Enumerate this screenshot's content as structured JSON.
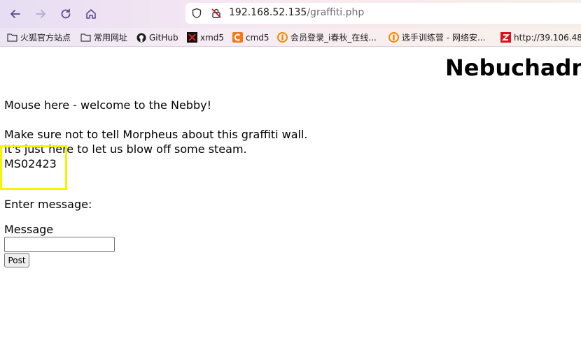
{
  "browser": {
    "url_host": "192.168.52.135",
    "url_path": "/graffiti.php",
    "accent_color": "#7b61b3",
    "bookmarks": [
      {
        "label": "火狐官方站点",
        "icon": "folder-icon"
      },
      {
        "label": "常用网址",
        "icon": "folder-icon"
      },
      {
        "label": "GitHub",
        "icon": "github-icon"
      },
      {
        "label": "xmd5",
        "icon": "xmd5-icon"
      },
      {
        "label": "cmd5",
        "icon": "cmd5-icon"
      },
      {
        "label": "会员登录_i春秋_在线...",
        "icon": "ichunqiu-icon"
      },
      {
        "label": "选手训练营 - 网络安...",
        "icon": "ichunqiu-icon"
      },
      {
        "label": "http://39.106.48...",
        "icon": "z-icon"
      }
    ]
  },
  "page": {
    "title": "Nebuchadne",
    "welcome": "Mouse here - welcome to the Nebby!",
    "graffiti": [
      "Make sure not to tell Morpheus about this graffiti wall.",
      "It's just here to let us blow off some steam.",
      "MS02423"
    ],
    "enter_message": "Enter message:",
    "message_label": "Message",
    "message_value": "",
    "post_label": "Post",
    "highlight_color": "#f5f500"
  }
}
